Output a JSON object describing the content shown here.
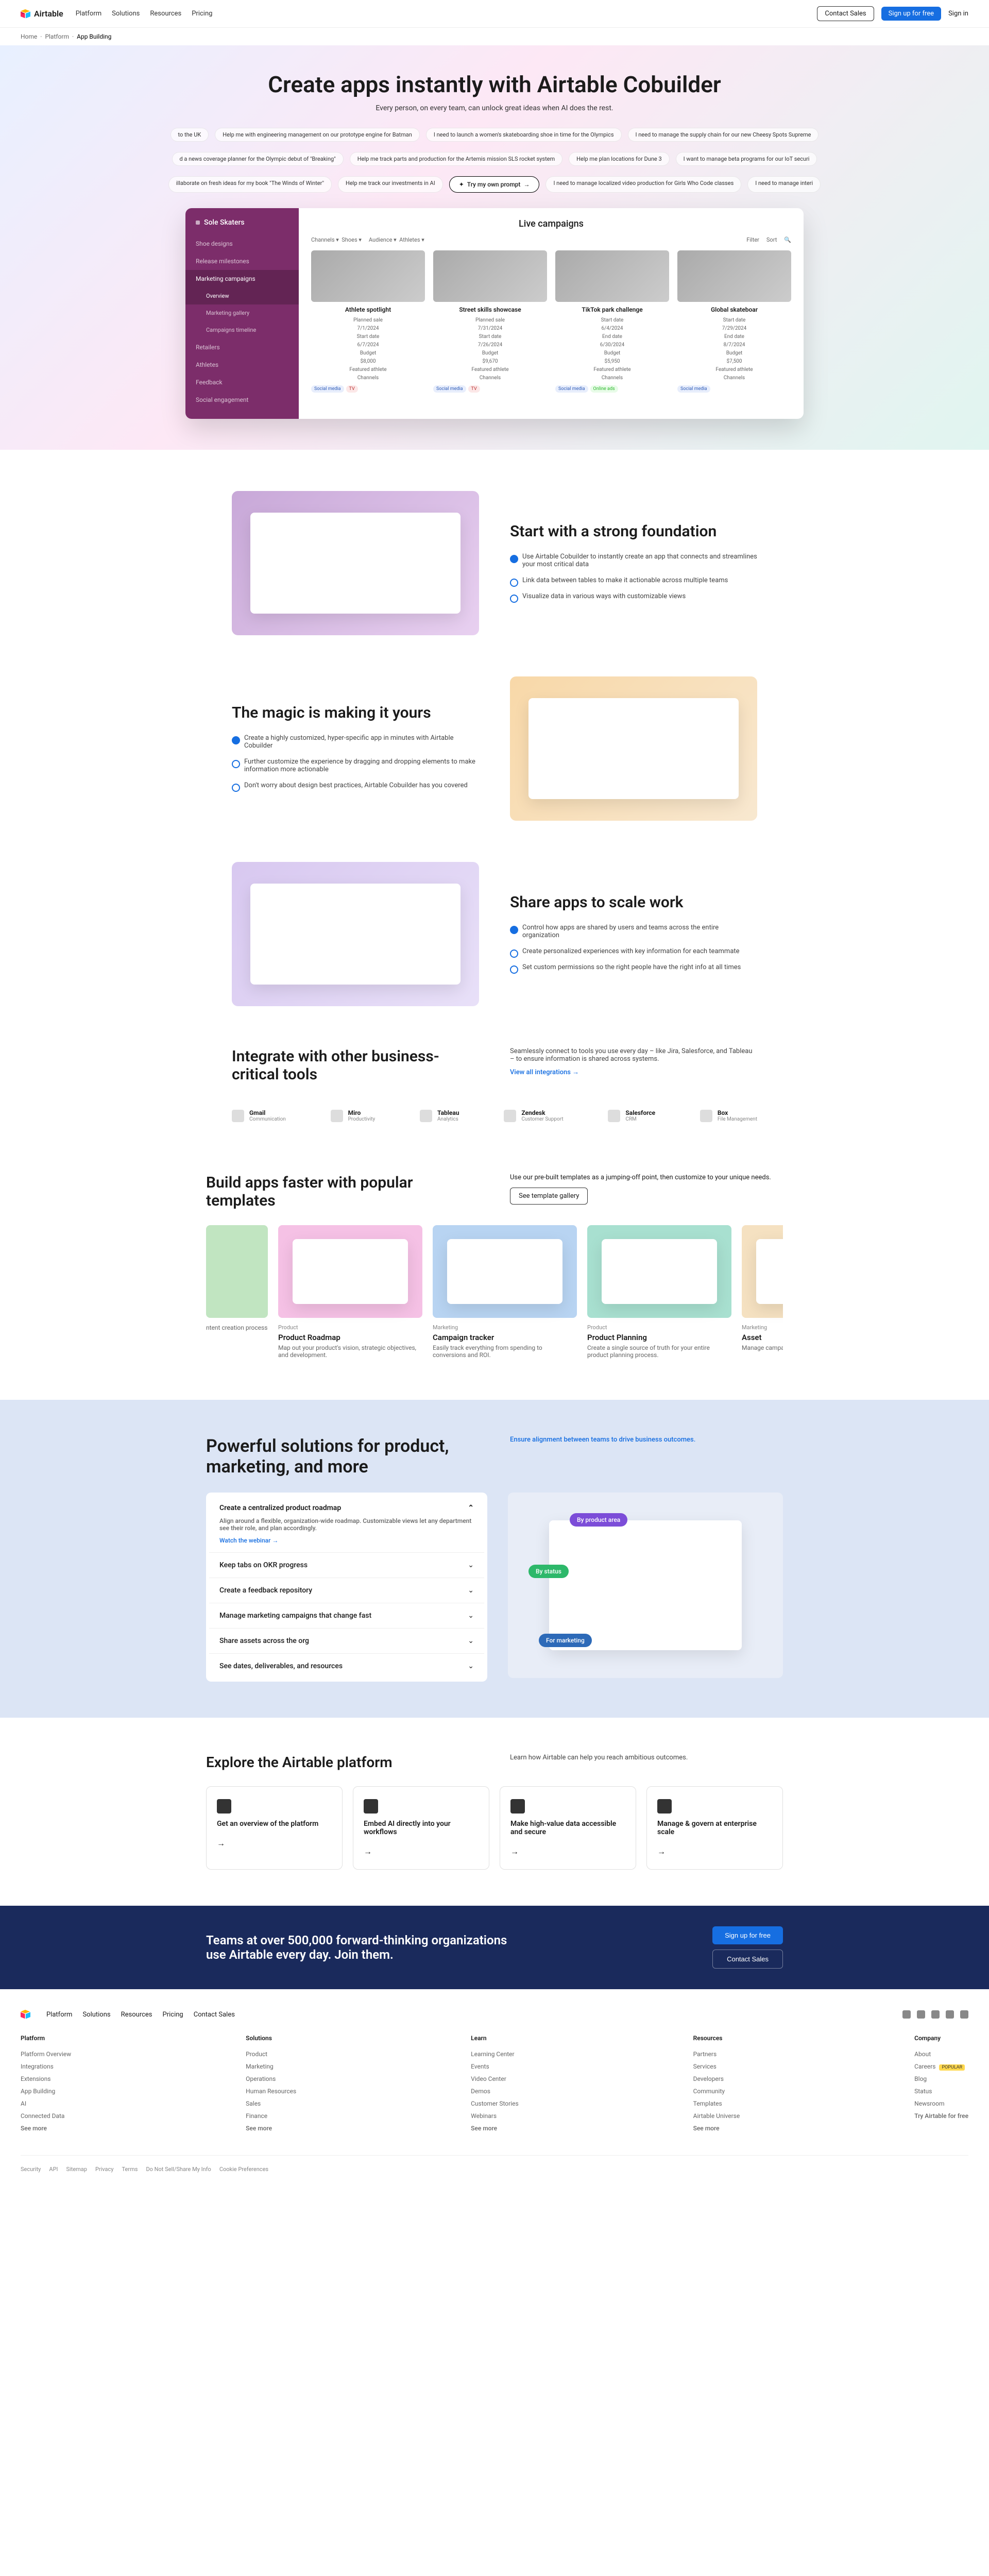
{
  "nav": {
    "brand": "Airtable",
    "links": [
      "Platform",
      "Solutions",
      "Resources",
      "Pricing"
    ],
    "contact": "Contact Sales",
    "signup": "Sign up for free",
    "signin": "Sign in"
  },
  "breadcrumb": [
    "Home",
    "Platform",
    "App Building"
  ],
  "hero": {
    "title": "Create apps instantly with Airtable Cobuilder",
    "subtitle": "Every person, on every team, can unlock great ideas when AI does the rest.",
    "prompts_row1": [
      "to the UK",
      "Help me with engineering management on our prototype engine for Batman",
      "I need to launch a women's skateboarding shoe in time for the Olympics",
      "I need to manage the supply chain for our new Cheesy Spots Supreme"
    ],
    "prompts_row2": [
      "d a news coverage planner for the Olympic debut of \"Breaking\"",
      "Help me track parts and production for the Artemis mission SLS rocket system",
      "Help me plan locations for Dune 3",
      "I want to manage beta programs for our IoT securi"
    ],
    "prompts_row3": [
      "illaborate on fresh ideas for my book \"The Winds of Winter\"",
      "Help me track our investments in AI",
      "",
      "I need to manage localized video production for Girls Who Code classes",
      "I need to manage interi"
    ],
    "try_label": "Try my own prompt"
  },
  "app_preview": {
    "workspace": "Sole Skaters",
    "sidebar": [
      {
        "label": "Shoe designs",
        "active": false
      },
      {
        "label": "Release milestones",
        "active": false
      },
      {
        "label": "Marketing campaigns",
        "active": true,
        "subs": [
          "Overview",
          "Marketing gallery",
          "Campaigns timeline"
        ]
      },
      {
        "label": "Retailers",
        "active": false
      },
      {
        "label": "Athletes",
        "active": false
      },
      {
        "label": "Feedback",
        "active": false
      },
      {
        "label": "Social engagement",
        "active": false
      }
    ],
    "main_title": "Live campaigns",
    "filters": [
      {
        "label": "Channels",
        "value": "Shoes"
      },
      {
        "label": "Audience",
        "value": "Athletes"
      }
    ],
    "filter_actions": [
      "Filter",
      "Sort"
    ],
    "cards": [
      {
        "title": "Athlete spotlight",
        "dates": "Planned sale\n7/1/2024\nStart date\n6/7/2024\nBudget\n$8,000",
        "label_footer": "Featured athlete",
        "channels": [
          "Social media",
          "TV"
        ]
      },
      {
        "title": "Street skills showcase",
        "dates": "Planned sale\n7/31/2024\nStart date\n7/26/2024\nBudget\n$9,670",
        "label_footer": "Featured athlete",
        "channels": [
          "Social media",
          "TV"
        ]
      },
      {
        "title": "TikTok park challenge",
        "dates": "Start date\n6/4/2024\nEnd date\n6/30/2024\nBudget\n$5,950",
        "label_footer": "Featured athlete",
        "channels": [
          "Social media",
          "Online ads"
        ]
      },
      {
        "title": "Global skateboar",
        "dates": "Start date\n7/29/2024\nEnd date\n8/7/2024\nBudget\n$7,500",
        "label_footer": "Featured athlete",
        "channels": [
          "Social media"
        ]
      }
    ]
  },
  "features": [
    {
      "title": "Start with a strong foundation",
      "bullets": [
        "Use Airtable Cobuilder to instantly create an app that connects and streamlines your most critical data",
        "Link data between tables to make it actionable across multiple teams",
        "Visualize data in various ways with customizable views"
      ]
    },
    {
      "title": "The magic is making it yours",
      "bullets": [
        "Create a highly customized, hyper-specific app in minutes with Airtable Cobuilder",
        "Further customize the experience by dragging and dropping elements to make information more actionable",
        "Don't worry about design best practices, Airtable Cobuilder has you covered"
      ]
    },
    {
      "title": "Share apps to scale work",
      "bullets": [
        "Control how apps are shared by users and teams across the entire organization",
        "Create personalized experiences with key information for each teammate",
        "Set custom permissions so the right people have the right info at all times"
      ]
    }
  ],
  "integrate": {
    "title": "Integrate with other business-critical tools",
    "desc": "Seamlessly connect to tools you use every day – like Jira, Salesforce, and Tableau – to ensure information is shared across systems.",
    "link": "View all integrations →",
    "items": [
      {
        "name": "Gmail",
        "sub": "Communication"
      },
      {
        "name": "Miro",
        "sub": "Productivity"
      },
      {
        "name": "Tableau",
        "sub": "Analytics"
      },
      {
        "name": "Zendesk",
        "sub": "Customer Support"
      },
      {
        "name": "Salesforce",
        "sub": "CRM"
      },
      {
        "name": "Box",
        "sub": "File Management"
      }
    ]
  },
  "templates": {
    "title": "Build apps faster with popular templates",
    "desc": "Use our pre-built templates as a jumping-off point, then customize to your unique needs.",
    "cta": "See template gallery",
    "items": [
      {
        "cat": "Product",
        "title": "Product Roadmap",
        "desc": "Map out your product's vision, strategic objectives, and development.",
        "bg": "#f5c1e5"
      },
      {
        "cat": "Marketing",
        "title": "Campaign tracker",
        "desc": "Easily track everything from spending to conversions and ROI.",
        "bg": "#b8d4f2"
      },
      {
        "cat": "Product",
        "title": "Product Planning",
        "desc": "Create a single source of truth for your entire product planning process.",
        "bg": "#a8e0d0"
      },
      {
        "cat": "Marketing",
        "title": "Asset",
        "desc": "Manage campaig",
        "bg": "#f5e1c1"
      }
    ],
    "partial_left": {
      "text": "ntent creation process",
      "bg": "#c1e5c1"
    }
  },
  "solutions": {
    "title": "Powerful solutions for product, marketing, and more",
    "subtitle": "Ensure alignment between teams to drive business outcomes.",
    "accordion": [
      {
        "title": "Create a centralized product roadmap",
        "open": true,
        "body": "Align around a flexible, organization-wide roadmap. Customizable views let any department see their role, and plan accordingly.",
        "link": "Watch the webinar →"
      },
      {
        "title": "Keep tabs on OKR progress"
      },
      {
        "title": "Create a feedback repository"
      },
      {
        "title": "Manage marketing campaigns that change fast"
      },
      {
        "title": "Share assets across the org"
      },
      {
        "title": "See dates, deliverables, and resources"
      }
    ],
    "chips": [
      "By product area",
      "By status",
      "For marketing"
    ]
  },
  "explore": {
    "title": "Explore the Airtable platform",
    "desc": "Learn how Airtable can help you reach ambitious outcomes.",
    "cards": [
      "Get an overview of the platform",
      "Embed AI directly into your workflows",
      "Make high-value data accessible and secure",
      "Manage & govern at enterprise scale"
    ]
  },
  "cta": {
    "title": "Teams at over 500,000 forward-thinking organizations use Airtable every day. Join them.",
    "primary": "Sign up for free",
    "secondary": "Contact Sales"
  },
  "footer": {
    "nav": [
      "Platform",
      "Solutions",
      "Resources",
      "Pricing",
      "Contact Sales"
    ],
    "cols": [
      {
        "title": "Platform",
        "items": [
          "Platform Overview",
          "Integrations",
          "Extensions",
          "App Building",
          "AI",
          "Connected Data",
          "See more"
        ]
      },
      {
        "title": "Solutions",
        "items": [
          "Product",
          "Marketing",
          "Operations",
          "Human Resources",
          "Sales",
          "Finance",
          "See more"
        ]
      },
      {
        "title": "Learn",
        "items": [
          "Learning Center",
          "Events",
          "Video Center",
          "Demos",
          "Customer Stories",
          "Webinars",
          "See more"
        ]
      },
      {
        "title": "Resources",
        "items": [
          "Partners",
          "Services",
          "Developers",
          "Community",
          "Templates",
          "Airtable Universe",
          "See more"
        ]
      },
      {
        "title": "Company",
        "items": [
          "About",
          "Careers",
          "Blog",
          "Status",
          "Newsroom",
          "Try Airtable for free"
        ]
      }
    ],
    "popular_badge": "POPULAR",
    "bottom": [
      "Security",
      "API",
      "Sitemap",
      "Privacy",
      "Terms",
      "Do Not Sell/Share My Info",
      "Cookie Preferences"
    ]
  }
}
